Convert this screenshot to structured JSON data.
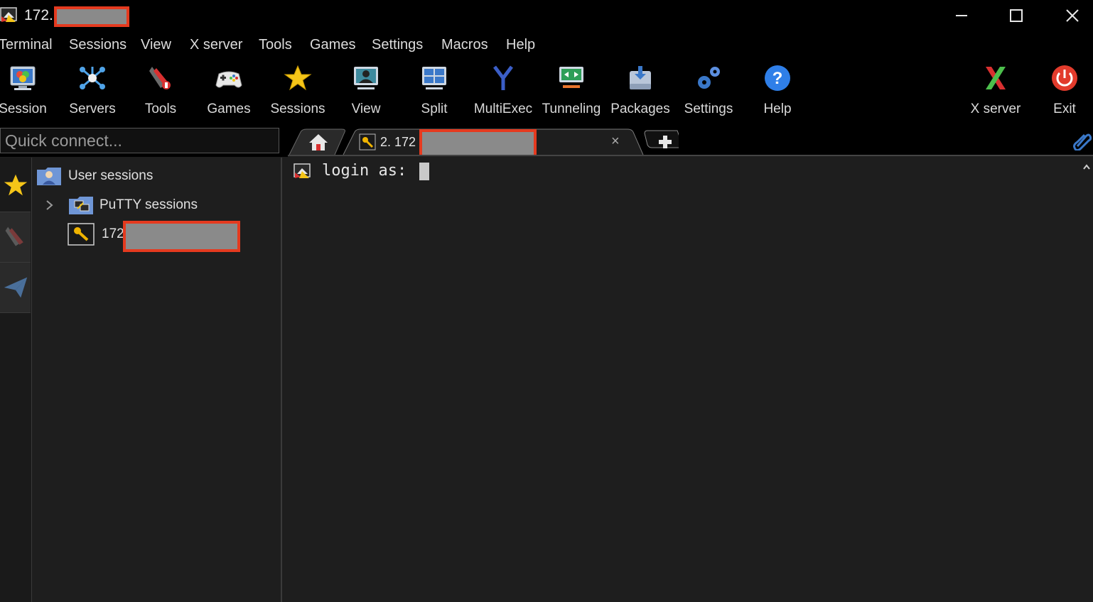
{
  "window": {
    "title": "172."
  },
  "menu": [
    "Terminal",
    "Sessions",
    "View",
    "X server",
    "Tools",
    "Games",
    "Settings",
    "Macros",
    "Help"
  ],
  "toolbar": {
    "session": "Session",
    "servers": "Servers",
    "tools": "Tools",
    "games": "Games",
    "sessions": "Sessions",
    "view": "View",
    "split": "Split",
    "multiexec": "MultiExec",
    "tunneling": "Tunneling",
    "packages": "Packages",
    "settings": "Settings",
    "help": "Help",
    "xserver": "X server",
    "exit": "Exit"
  },
  "quick_connect": {
    "placeholder": "Quick connect..."
  },
  "tabs": {
    "active_label": "2. 172",
    "close": "×"
  },
  "tree": {
    "user_sessions": "User sessions",
    "putty_sessions": "PuTTY sessions",
    "session_172": "172"
  },
  "terminal": {
    "prompt": "login as: "
  },
  "colors": {
    "accent_red": "#e53a1f",
    "background": "#1e1e1e"
  }
}
